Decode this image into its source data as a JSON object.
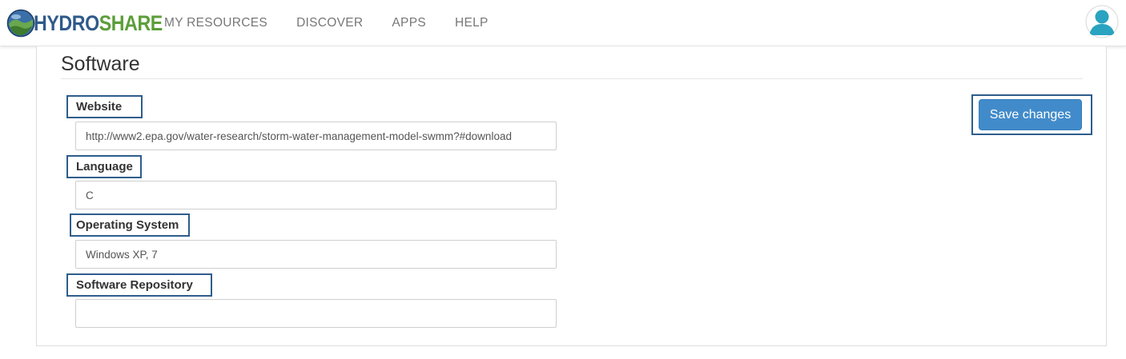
{
  "brand": {
    "part1": "HYDRO",
    "part2": "SHARE"
  },
  "nav": {
    "items": [
      {
        "label": "MY RESOURCES"
      },
      {
        "label": "DISCOVER"
      },
      {
        "label": "APPS"
      },
      {
        "label": "HELP"
      }
    ]
  },
  "section": {
    "title": "Software"
  },
  "fields": {
    "website": {
      "label": "Website",
      "value": "http://www2.epa.gov/water-research/storm-water-management-model-swmm?#download"
    },
    "language": {
      "label": "Language",
      "value": "C"
    },
    "operating_system": {
      "label": "Operating System",
      "value": "Windows XP, 7"
    },
    "software_repository": {
      "label": "Software Repository",
      "value": ""
    }
  },
  "actions": {
    "save_label": "Save changes"
  },
  "colors": {
    "brand_blue": "#2f5a8a",
    "brand_green": "#5c9e3a",
    "primary_button": "#428bca",
    "highlight_border": "#2e5d8c",
    "avatar": "#2aa3c0"
  },
  "icons": {
    "logo": "globe-logo-icon",
    "avatar": "user-avatar-icon"
  }
}
